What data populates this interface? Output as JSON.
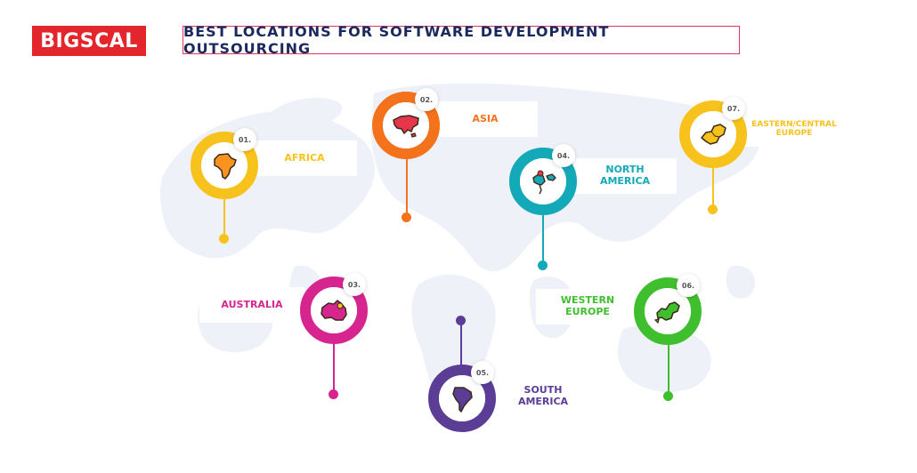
{
  "brand": {
    "logo_text": "BIGSCAL"
  },
  "title": "BEST LOCATIONS FOR SOFTWARE DEVELOPMENT OUTSOURCING",
  "locations": [
    {
      "number": "01.",
      "line1": "AFRICA",
      "line2": "",
      "color": "#f8c21c",
      "icon": "africa-map-icon"
    },
    {
      "number": "02.",
      "line1": "ASIA",
      "line2": "",
      "color": "#f5721d",
      "icon": "asia-map-icon"
    },
    {
      "number": "03.",
      "line1": "AUSTRALIA",
      "line2": "",
      "color": "#d7258f",
      "icon": "australia-map-icon"
    },
    {
      "number": "04.",
      "line1": "NORTH",
      "line2": "AMERICA",
      "color": "#13a9b8",
      "icon": "north-america-map-icon"
    },
    {
      "number": "05.",
      "line1": "SOUTH",
      "line2": "AMERICA",
      "color": "#5b3d96",
      "icon": "south-america-map-icon"
    },
    {
      "number": "06.",
      "line1": "WESTERN",
      "line2": "EUROPE",
      "color": "#3fbf2e",
      "icon": "western-europe-map-icon"
    },
    {
      "number": "07.",
      "line1": "EASTERN/CENTRAL",
      "line2": "EUROPE",
      "color": "#f8c21c",
      "icon": "eastern-europe-map-icon"
    }
  ]
}
